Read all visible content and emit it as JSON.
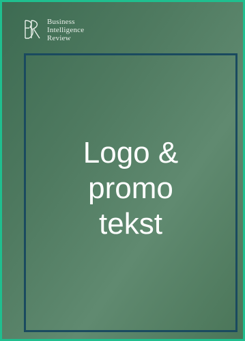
{
  "brand": {
    "logo_icon": "business-intelligence-review-monogram",
    "line1": "Business",
    "line2": "Intelligence",
    "line3": "Review"
  },
  "promo": {
    "line1": "Logo &",
    "line2": "promo",
    "line3": "tekst"
  },
  "colors": {
    "outer_border": "#1fbf8f",
    "inner_frame": "#1a4a5f",
    "background": "#4f7a60",
    "text": "#ffffff"
  }
}
